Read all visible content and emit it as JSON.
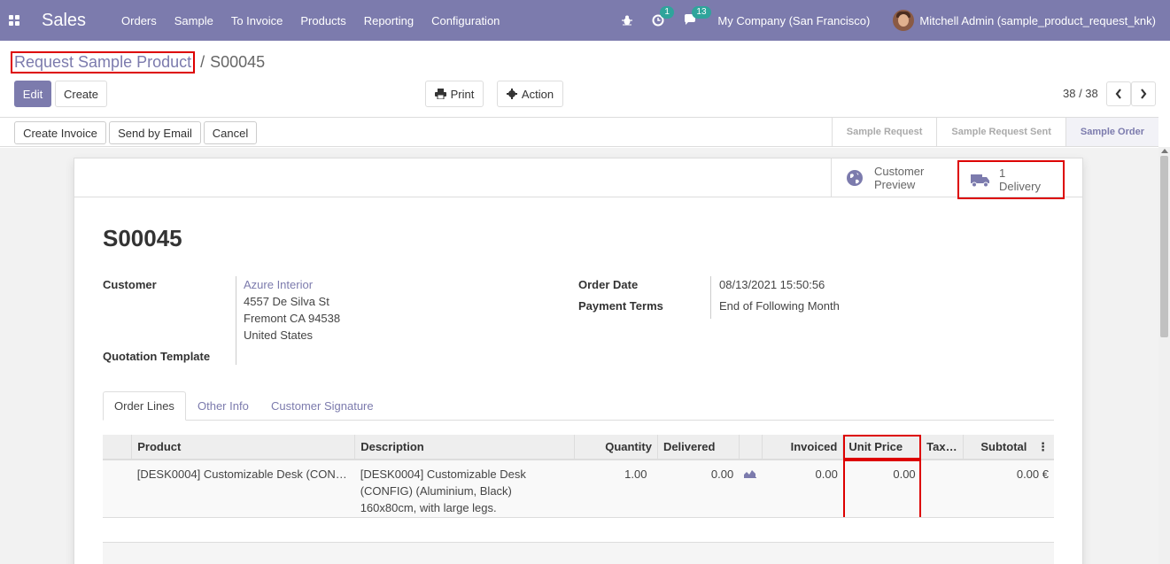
{
  "navbar": {
    "app_name": "Sales",
    "menu": [
      "Orders",
      "Sample",
      "To Invoice",
      "Products",
      "Reporting",
      "Configuration"
    ],
    "activity_count": "1",
    "messages_count": "13",
    "company": "My Company (San Francisco)",
    "user": "Mitchell Admin (sample_product_request_knk)"
  },
  "breadcrumb": {
    "parent": "Request Sample Product",
    "separator": "/",
    "current": "S00045"
  },
  "buttons": {
    "edit": "Edit",
    "create": "Create",
    "print": "Print",
    "action": "Action"
  },
  "pager": {
    "value": "38 / 38"
  },
  "statusbar": {
    "create_invoice": "Create Invoice",
    "send_email": "Send by Email",
    "cancel": "Cancel",
    "stages": [
      "Sample Request",
      "Sample Request Sent",
      "Sample Order"
    ]
  },
  "smart_buttons": {
    "preview_line1": "Customer",
    "preview_line2": "Preview",
    "delivery_count": "1",
    "delivery_label": "Delivery"
  },
  "order": {
    "name": "S00045",
    "customer_label": "Customer",
    "customer_name": "Azure Interior",
    "address_line1": "4557 De Silva St",
    "address_line2": "Fremont CA 94538",
    "address_line3": "United States",
    "quotation_template_label": "Quotation Template",
    "order_date_label": "Order Date",
    "order_date": "08/13/2021 15:50:56",
    "payment_terms_label": "Payment Terms",
    "payment_terms": "End of Following Month"
  },
  "tabs": [
    "Order Lines",
    "Other Info",
    "Customer Signature"
  ],
  "table": {
    "headers": {
      "product": "Product",
      "description": "Description",
      "quantity": "Quantity",
      "delivered": "Delivered",
      "invoiced": "Invoiced",
      "unit_price": "Unit Price",
      "taxes": "Tax…",
      "subtotal": "Subtotal"
    },
    "rows": [
      {
        "product": "[DESK0004] Customizable Desk (CON…",
        "description_line1": "[DESK0004] Customizable Desk",
        "description_line2": "(CONFIG) (Aluminium, Black)",
        "description_line3": "160x80cm, with large legs.",
        "quantity": "1.00",
        "delivered": "0.00",
        "invoiced": "0.00",
        "unit_price": "0.00",
        "subtotal": "0.00 €"
      }
    ]
  }
}
